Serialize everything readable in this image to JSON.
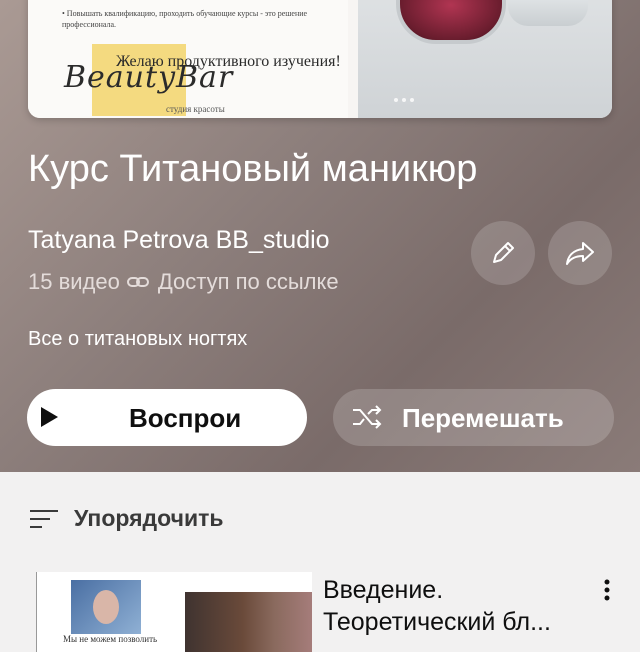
{
  "playlist": {
    "title": "Курс Титановый маникюр",
    "author": "Tatyana Petrova BB_studio",
    "video_count": "15 видео",
    "access": "Доступ по ссылке",
    "description": "Все о титановых ногтях",
    "thumbnail": {
      "bullet_text": "• Повышать квалификацию, проходить обучающие курсы - это решение профессионала.",
      "wish_text": "Желаю продуктивного изучения!",
      "logo_text": "BeautyBar",
      "logo_sub": "студия красоты"
    }
  },
  "actions": {
    "play_label": "Воспрои",
    "shuffle_label": "Перемешать"
  },
  "sort": {
    "label": "Упорядочить"
  },
  "videos": [
    {
      "title": "Введение. Теоретический бл...",
      "thumb_caption": "Мы не можем позволить"
    }
  ]
}
